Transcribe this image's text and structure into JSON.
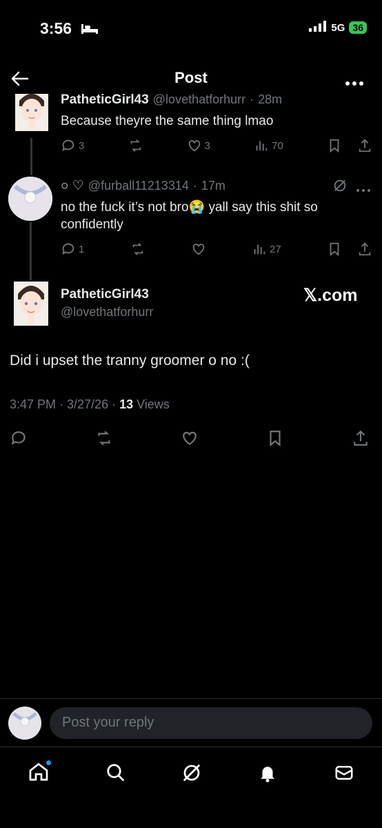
{
  "status_bar": {
    "time": "3:56",
    "network": "5G",
    "battery": "36"
  },
  "header": {
    "title": "Post"
  },
  "replies": [
    {
      "name": "PatheticGirl43",
      "handle": "@lovethatforhurr",
      "time": "28m",
      "text": "Because theyre the same thing lmao",
      "stats": {
        "replies": "3",
        "reposts": "",
        "likes": "3",
        "views": "70"
      }
    },
    {
      "name_prefix": "○ ♡",
      "handle": "@furball11213314",
      "time": "17m",
      "text": "no the fuck it’s not bro😭 yall say this shit so confidently",
      "stats": {
        "replies": "1",
        "reposts": "",
        "likes": "",
        "views": "27"
      }
    }
  ],
  "main_post": {
    "name": "PatheticGirl43",
    "handle": "@lovethatforhurr",
    "watermark": "𝕏.com",
    "text": "Did i upset the tranny groomer o no :(",
    "timestamp": "3:47 PM · 3/27/26 ·",
    "views_count": "13",
    "views_label": "Views"
  },
  "reply_bar": {
    "placeholder": "Post your reply"
  },
  "colors": {
    "background": "#000000",
    "text": "#e7e9ea",
    "muted": "#71767b",
    "accent": "#1d9bf0"
  }
}
